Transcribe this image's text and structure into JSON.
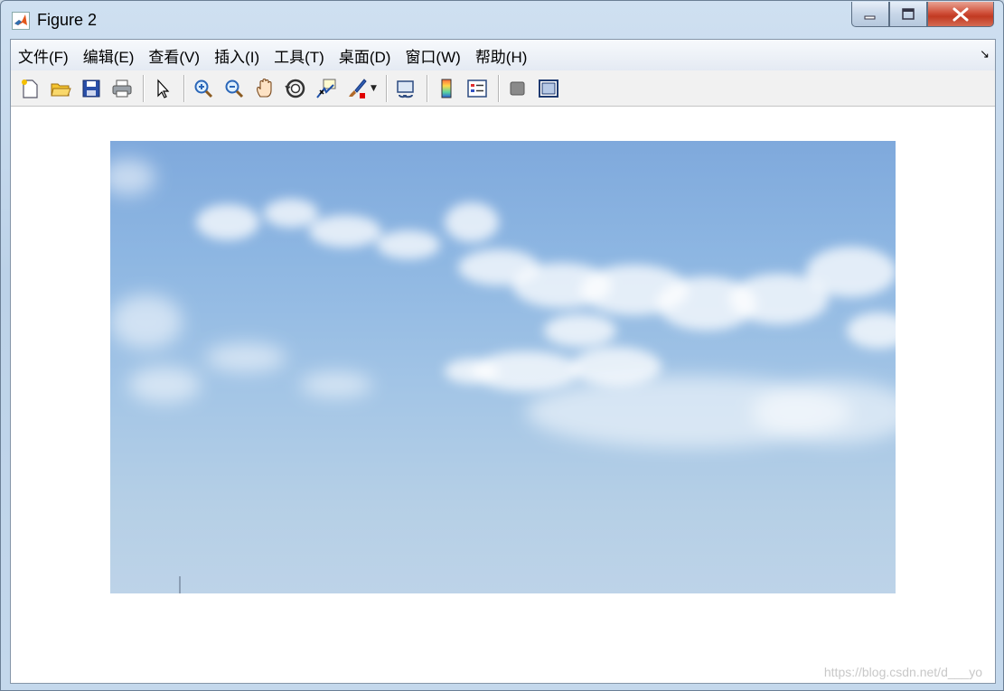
{
  "window": {
    "title": "Figure 2"
  },
  "menu": {
    "items": [
      {
        "label": "文件(F)"
      },
      {
        "label": "编辑(E)"
      },
      {
        "label": "查看(V)"
      },
      {
        "label": "插入(I)"
      },
      {
        "label": "工具(T)"
      },
      {
        "label": "桌面(D)"
      },
      {
        "label": "窗口(W)"
      },
      {
        "label": "帮助(H)"
      }
    ],
    "corner_glyph": "↘"
  },
  "toolbar": {
    "icons": [
      "new-figure-icon",
      "open-file-icon",
      "save-icon",
      "print-icon",
      "edit-plot-arrow-icon",
      "zoom-in-icon",
      "zoom-out-icon",
      "pan-hand-icon",
      "rotate-3d-icon",
      "data-cursor-icon",
      "brush-icon",
      "link-plot-icon",
      "colorbar-icon",
      "legend-icon",
      "hide-plot-tools-icon",
      "show-plot-tools-icon"
    ]
  },
  "figure": {
    "image_description_color_top": "#7fa9dc",
    "image_description_color_bottom": "#bdd3e8"
  },
  "watermark": {
    "text": "https://blog.csdn.net/d___yo"
  }
}
